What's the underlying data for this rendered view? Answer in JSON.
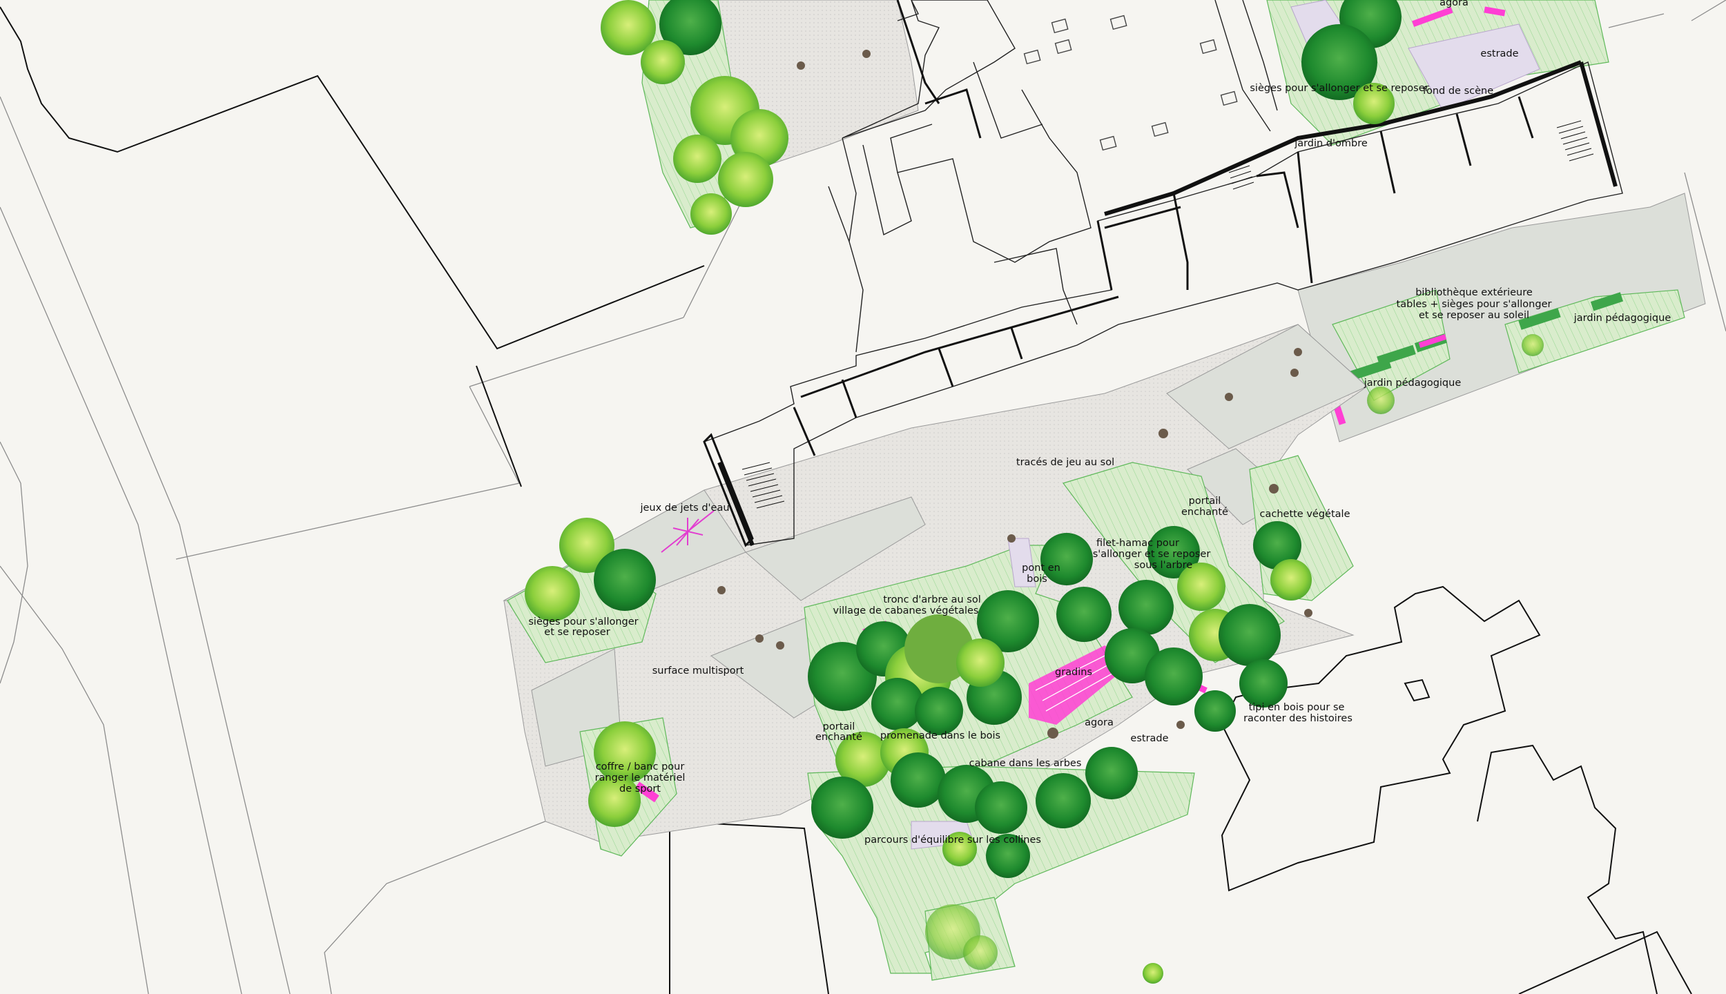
{
  "colors": {
    "background": "#f6f5f1",
    "building_line": "#111111",
    "street_line": "#8c8c8c",
    "playground_paving": "#e7e5e1",
    "paving_grey": "#dcdfd9",
    "planted_area": "#d9eccc",
    "planted_outline": "#5fb85a",
    "accent_pink": "#ff3fd4",
    "tree_dark": "#1e8a2e",
    "tree_light": "#8ccf3c"
  },
  "labels": {
    "agora_top": "agora",
    "estrade_top": "estrade",
    "sieges_top": "sièges pour s'allonger et se reposer",
    "fond_de_scene": "fond de scène",
    "jardin_ombre": "jardin d'ombre",
    "bibliotheque_1": "bibliothèque extérieure",
    "bibliotheque_2": "tables + sièges pour s'allonger",
    "bibliotheque_3": "et se reposer au soleil",
    "jardin_pedagogique_1": "jardin pédagogique",
    "jardin_pedagogique_2": "jardin pédagogique",
    "traces_jeu": "tracés de jeu au sol",
    "portail_enchante_top_1": "portail",
    "portail_enchante_top_2": "enchanté",
    "cachette": "cachette végétale",
    "jeux_jets_eau": "jeux de jets d'eau",
    "filet_hamac_1": "filet-hamac pour",
    "filet_hamac_2": "s'allonger et se reposer",
    "filet_hamac_3": "sous l'arbre",
    "pont_1": "pont en",
    "pont_2": "bois",
    "tronc_1": "tronc d'arbre au sol",
    "tronc_2": "village de cabanes végétales",
    "sieges_left_1": "sièges pour s'allonger",
    "sieges_left_2": "et se reposer",
    "surface_multisport": "surface multisport",
    "gradins": "gradins",
    "tipi_1": "tipi en bois pour se",
    "tipi_2": "raconter des histoires",
    "portail_enchante_1": "portail",
    "portail_enchante_2": "enchanté",
    "promenade": "promenade dans le bois",
    "agora_main": "agora",
    "estrade_main": "estrade",
    "cabane": "cabane dans les arbes",
    "coffre_1": "coffre / banc pour",
    "coffre_2": "ranger le matériel",
    "coffre_3": "de sport",
    "parcours": "parcours d'équilibre sur les collines"
  }
}
